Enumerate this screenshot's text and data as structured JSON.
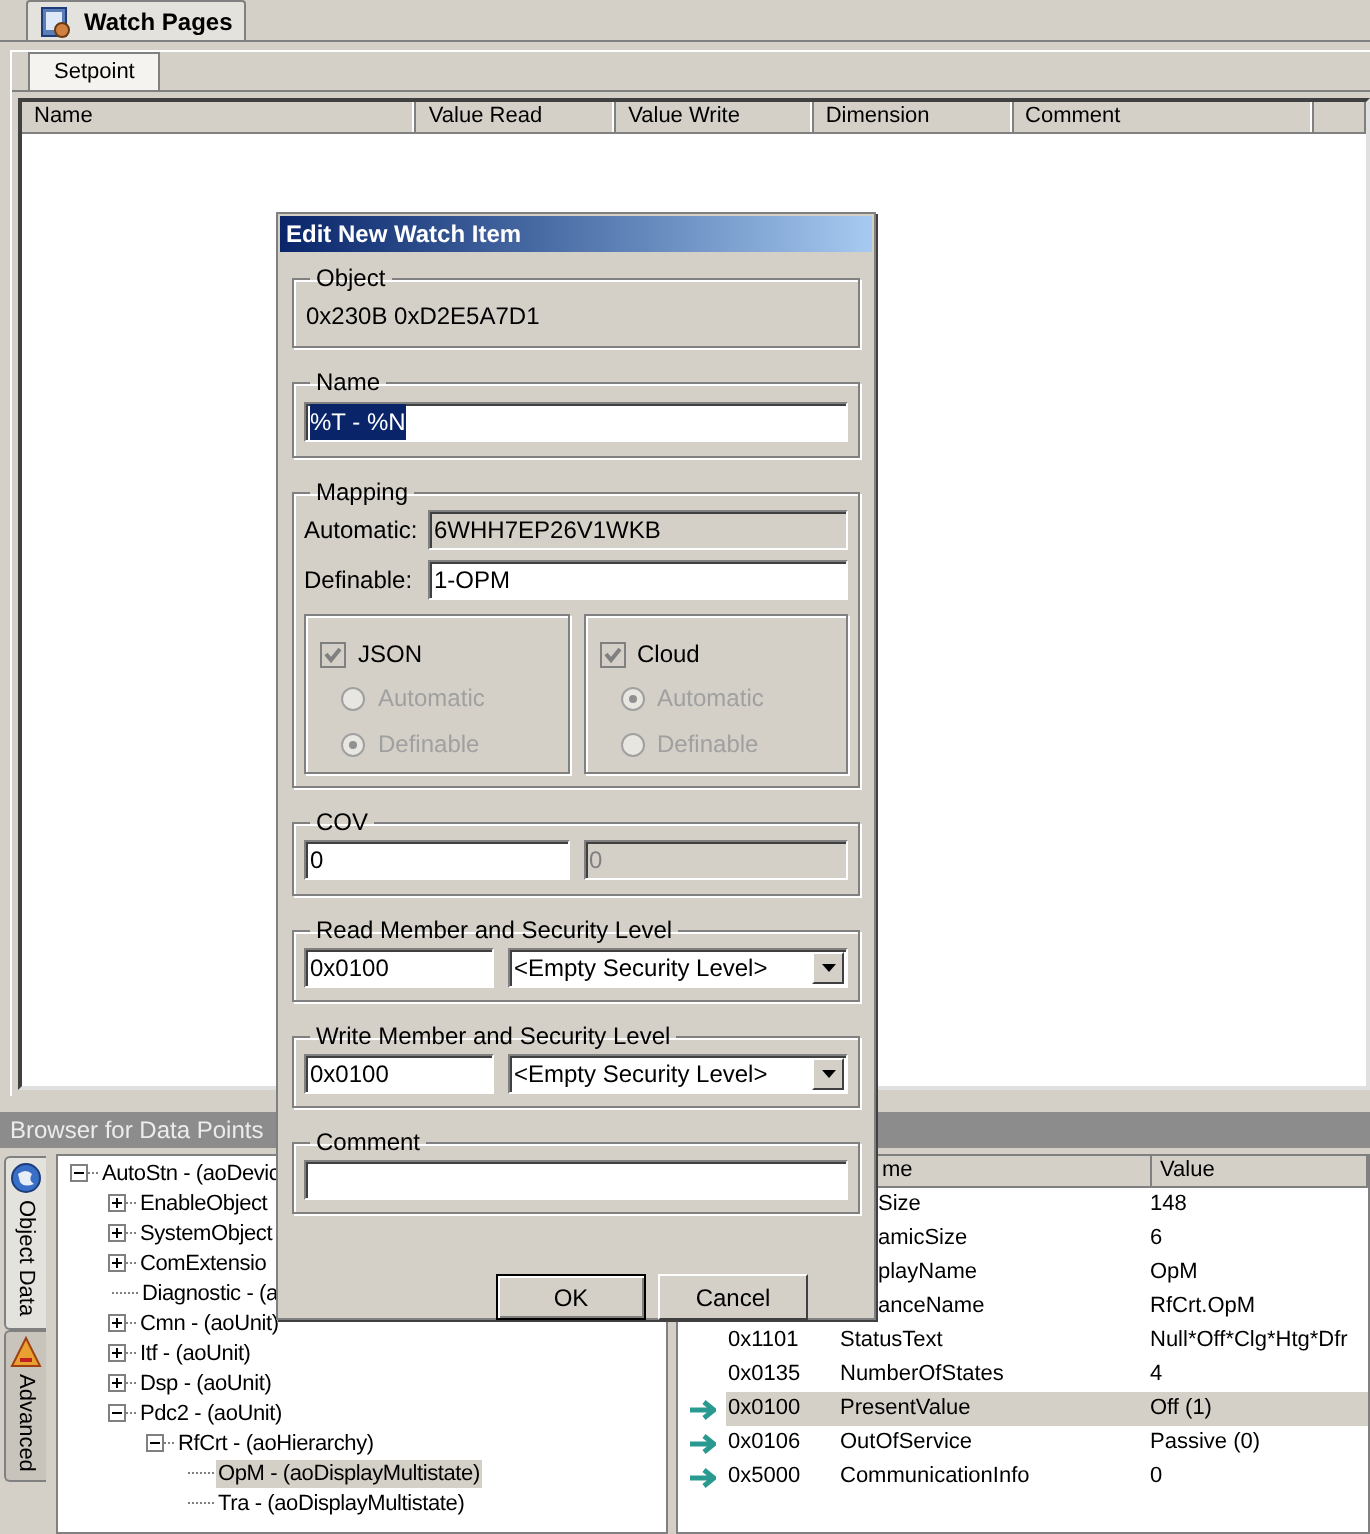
{
  "tabs": [
    {
      "label": "Watch Pages",
      "selected": true
    }
  ],
  "page_tabs": [
    {
      "label": "Setpoint",
      "selected": true
    }
  ],
  "watch_table": {
    "columns": [
      "Name",
      "Value Read",
      "Value Write",
      "Dimension",
      "Comment"
    ]
  },
  "dialog": {
    "title": "Edit New Watch Item",
    "object": {
      "label": "Object",
      "value": "0x230B 0xD2E5A7D1"
    },
    "name": {
      "label": "Name",
      "value": "%T - %N",
      "text_selected": true
    },
    "mapping": {
      "label": "Mapping",
      "automatic": {
        "label": "Automatic:",
        "value": "6WHH7EP26V1WKB",
        "disabled": true
      },
      "definable": {
        "label": "Definable:",
        "value": "1-OPM",
        "disabled": false
      },
      "targets": [
        {
          "label": "JSON",
          "checked": true,
          "disabled": true,
          "options": [
            {
              "label": "Automatic",
              "selected": false
            },
            {
              "label": "Definable",
              "selected": true
            }
          ]
        },
        {
          "label": "Cloud",
          "checked": true,
          "disabled": true,
          "options": [
            {
              "label": "Automatic",
              "selected": true
            },
            {
              "label": "Definable",
              "selected": false
            }
          ]
        }
      ]
    },
    "cov": {
      "label": "COV",
      "fields": [
        {
          "value": "0",
          "disabled": false
        },
        {
          "value": "0",
          "disabled": true
        }
      ]
    },
    "read_member": {
      "label": "Read Member and Security Level",
      "member": "0x0100",
      "security_level": "<Empty Security Level>"
    },
    "write_member": {
      "label": "Write Member and Security Level",
      "member": "0x0100",
      "security_level": "<Empty Security Level>"
    },
    "comment": {
      "label": "Comment"
    },
    "buttons": [
      {
        "label": "OK",
        "default": true
      },
      {
        "label": "Cancel",
        "default": false
      }
    ]
  },
  "browser": {
    "title": "Browser for Data Points",
    "side_tabs": [
      {
        "label": "Object Data",
        "selected": true
      },
      {
        "label": "Advanced",
        "selected": false
      }
    ],
    "tree": [
      {
        "label": "AutoStn - (aoDevic",
        "expanded": true,
        "selected": false,
        "children": [
          {
            "label": "EnableObject",
            "expanded": false,
            "selected": false
          },
          {
            "label": "SystemObject",
            "expanded": false,
            "selected": false
          },
          {
            "label": "ComExtensio",
            "expanded": false,
            "selected": false
          },
          {
            "label": "Diagnostic - (a",
            "selected": false
          },
          {
            "label": "Cmn - (aoUnit)",
            "expanded": false,
            "selected": false
          },
          {
            "label": "Itf - (aoUnit)",
            "expanded": false,
            "selected": false
          },
          {
            "label": "Dsp - (aoUnit)",
            "expanded": false,
            "selected": false
          },
          {
            "label": "Pdc2 - (aoUnit)",
            "expanded": true,
            "selected": false,
            "children": [
              {
                "label": "RfCrt - (aoHierarchy)",
                "expanded": true,
                "selected": false,
                "children": [
                  {
                    "label": "OpM - (aoDisplayMultistate)",
                    "selected": true
                  },
                  {
                    "label": "Tra - (aoDisplayMultistate)",
                    "selected": false
                  }
                ]
              }
            ]
          }
        ]
      }
    ],
    "properties": {
      "columns": [
        "me",
        "Value"
      ],
      "rows": [
        {
          "name": "Size",
          "value": "148",
          "linked": false,
          "selected": false
        },
        {
          "name": "amicSize",
          "value": "6",
          "linked": false,
          "selected": false
        },
        {
          "name": "playName",
          "value": "OpM",
          "linked": false,
          "selected": false
        },
        {
          "name": "anceName",
          "value": "RfCrt.OpM",
          "linked": false,
          "selected": false
        },
        {
          "id": "0x1101",
          "name": "StatusText",
          "value": "Null*Off*Clg*Htg*Dfr",
          "linked": false,
          "selected": false
        },
        {
          "id": "0x0135",
          "name": "NumberOfStates",
          "value": "4",
          "linked": false,
          "selected": false
        },
        {
          "id": "0x0100",
          "name": "PresentValue",
          "value": "Off (1)",
          "linked": true,
          "selected": true
        },
        {
          "id": "0x0106",
          "name": "OutOfService",
          "value": "Passive (0)",
          "linked": true,
          "selected": false
        },
        {
          "id": "0x5000",
          "name": "CommunicationInfo",
          "value": "0",
          "linked": true,
          "selected": false
        }
      ]
    }
  }
}
